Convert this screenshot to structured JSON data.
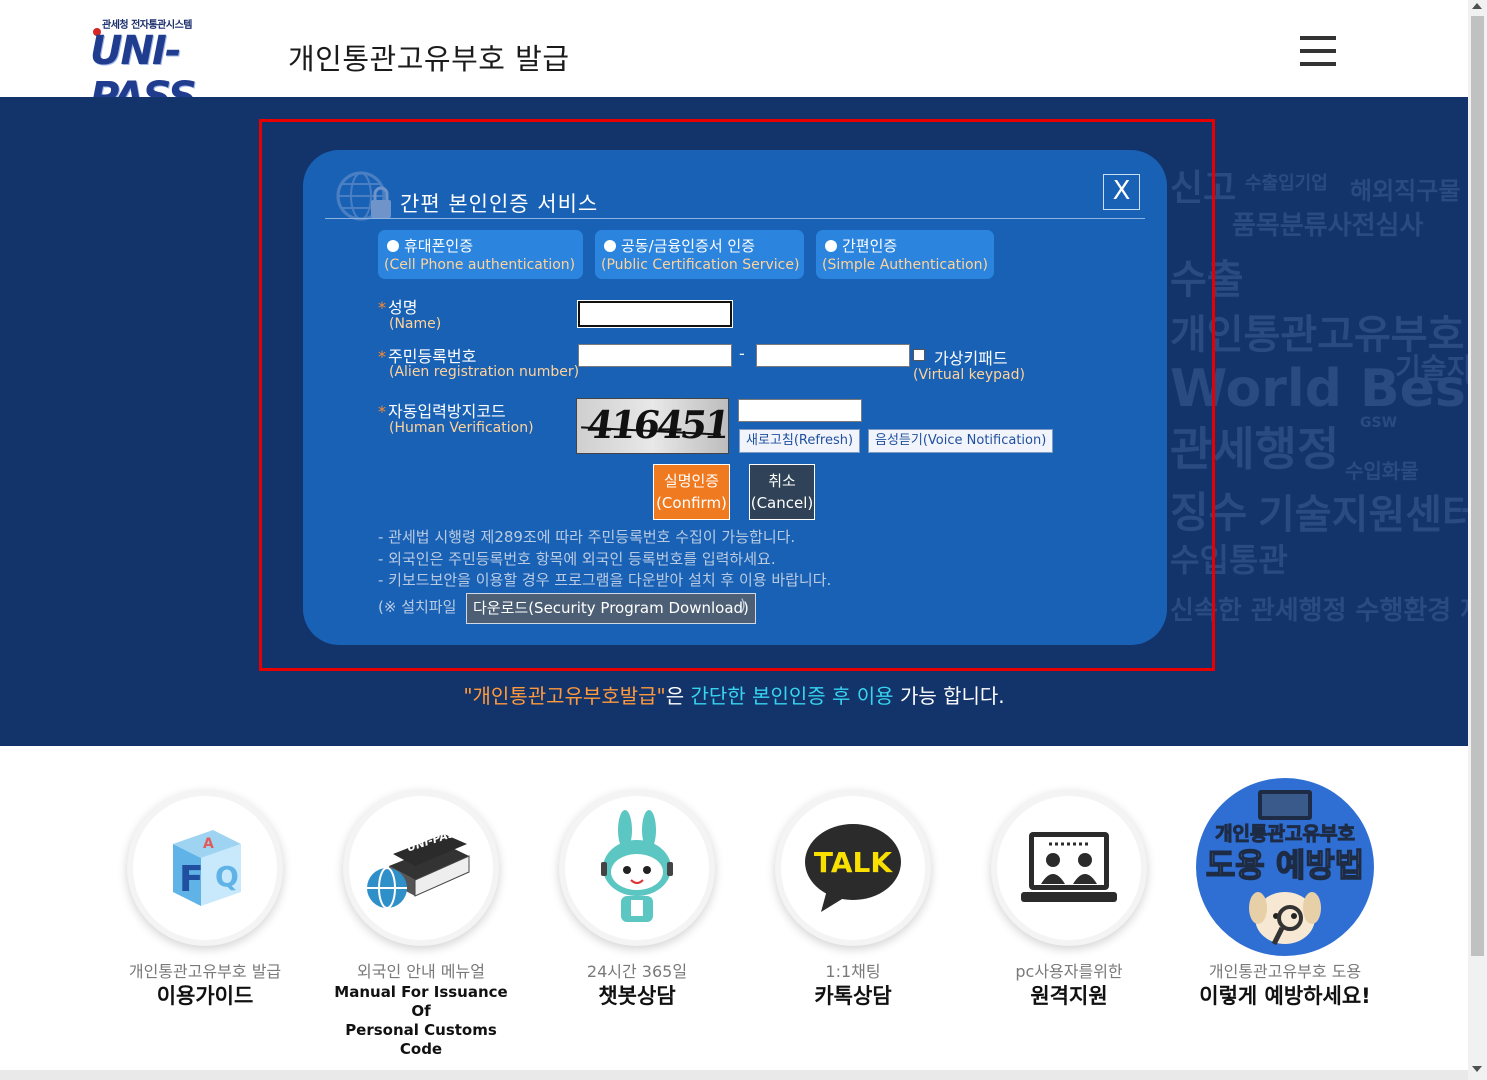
{
  "header": {
    "logo_small": "관세청 전자통관시스템",
    "logo_text": "UNI-PASS",
    "title": "개인통관고유부호 발급",
    "menu_icon": "hamburger-menu-icon"
  },
  "background_words": [
    "신고",
    "수출입기업",
    "해외직구물",
    "품목분류사전심사",
    "수출",
    "개인통관고유부호",
    "기술지",
    "World Best",
    "관세행정",
    "징수",
    "기술지원센터",
    "수입통관",
    "수입화물",
    "신속한 관세행정 수행환경 제공",
    "GSW"
  ],
  "dialog": {
    "title": "간편 본인인증 서비스",
    "close_label": "X",
    "auth_options": [
      {
        "label": "휴대폰인증",
        "sub": "(Cell Phone authentication)"
      },
      {
        "label": "공동/금융인증서 인증",
        "sub": "(Public Certification Service)"
      },
      {
        "label": "간편인증",
        "sub": "(Simple Authentication)"
      }
    ],
    "name": {
      "label": "성명",
      "sub": "(Name)",
      "value": ""
    },
    "rrn": {
      "label": "주민등록번호",
      "sub": "(Alien registration number)",
      "dash": "-",
      "value1": "",
      "value2": ""
    },
    "virtual_keypad": {
      "label": "가상키패드",
      "sub": "(Virtual keypad)",
      "checked": false
    },
    "captcha": {
      "label": "자동입력방지코드",
      "sub": "(Human Verification)",
      "image_text": "416451",
      "value": ""
    },
    "refresh_button": "새로고침(Refresh)",
    "voice_button": "음성듣기(Voice Notification)",
    "confirm_button": {
      "line1": "실명인증",
      "line2": "(Confirm)"
    },
    "cancel_button": {
      "line1": "취소",
      "line2": "(Cancel)"
    },
    "notices": [
      "- 관세법 시행령 제289조에 따라 주민등록번호 수집이 가능합니다.",
      "- 외국인은 주민등록번호 항목에 외국인 등록번호를 입력하세요.",
      "- 키보드보안을 이용할 경우 프로그램을 다운받아 설치 후 이용 바랍니다."
    ],
    "download_prefix": "(※ 설치파일",
    "download_button": "다운로드(Security Program Download)",
    "download_suffix": ")"
  },
  "caption": {
    "quote_open": "\"",
    "highlight": "개인통관고유부호발급",
    "quote_close": "\"",
    "part_a": "은",
    "part_b": "간단한 본인인증 후 이용",
    "part_c": "가능 합니다."
  },
  "quick_menu": [
    {
      "small": "개인통관고유부호 발급",
      "big": "이용가이드",
      "icon": "faq-cube-icon"
    },
    {
      "small": "외국인 안내 메뉴얼",
      "big_en": [
        "Manual For Issuance Of",
        "Personal Customs Code"
      ],
      "icon": "manual-book-icon"
    },
    {
      "small": "24시간 365일",
      "big": "챗봇상담",
      "icon": "chatbot-rabbit-icon"
    },
    {
      "small": "1:1채팅",
      "big": "카톡상담",
      "icon": "kakaotalk-icon"
    },
    {
      "small": "pc사용자를위한",
      "big": "원격지원",
      "icon": "remote-support-icon"
    },
    {
      "small": "개인통관고유부호 도용",
      "big": "이렇게 예방하세요!",
      "icon": "misuse-prevention-icon",
      "badge_line1": "개인통관고유부호",
      "badge_line2": "도용 예방법"
    }
  ],
  "colors": {
    "hero_bg": "#13336b",
    "dialog_bg": "#1961b5",
    "highlight_frame": "#e80000",
    "confirm": "#f07a1f",
    "accent_orange": "#ff9a3c",
    "accent_cyan": "#37d4f0"
  }
}
